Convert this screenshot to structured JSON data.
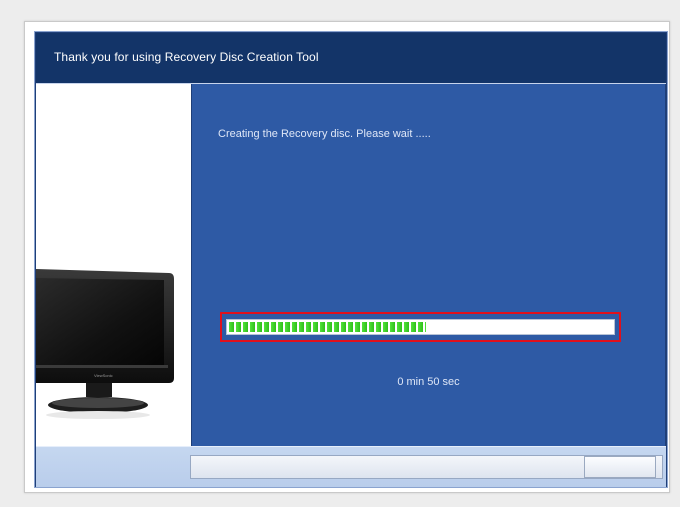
{
  "window": {
    "title": "Thank you for using Recovery Disc Creation Tool"
  },
  "status": {
    "message": "Creating the Recovery disc. Please wait .....",
    "remaining_time": "0 min 50 sec"
  },
  "progress": {
    "fraction": 0.51,
    "fill_color": "#3bcf24",
    "highlight_color": "#e0101c"
  },
  "product_image": {
    "icon": "monitor-icon",
    "brand": "ViewSonic"
  },
  "colors": {
    "titlebar": "#133468",
    "content": "#2e5aa5",
    "footer": "#c5d7f0"
  }
}
